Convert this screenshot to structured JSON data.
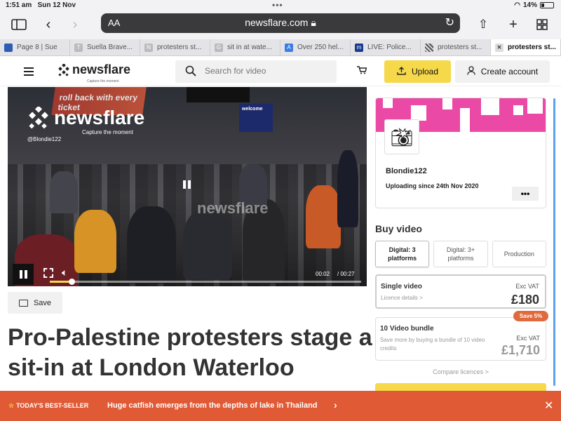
{
  "status_bar": {
    "time": "1:51 am",
    "date": "Sun 12 Nov",
    "battery": "14%"
  },
  "browser": {
    "text_size_label": "AA",
    "url": "newsflare.com",
    "tabs": [
      {
        "label": "Page 8 | Sue",
        "favicon": "leaf"
      },
      {
        "label": "Suella Brave...",
        "favicon": "T"
      },
      {
        "label": "protesters st...",
        "favicon": "N"
      },
      {
        "label": "sit in at wate...",
        "favicon": "G"
      },
      {
        "label": "Over 250 hel...",
        "favicon": "AoL"
      },
      {
        "label": "LIVE: Police...",
        "favicon": "m"
      },
      {
        "label": "protesters st...",
        "favicon": "nf"
      },
      {
        "label": "protesters st...",
        "favicon": "close",
        "active": true
      }
    ]
  },
  "site": {
    "logo": "newsflare",
    "logo_tagline": "Capture the moment",
    "search_placeholder": "Search for video",
    "upload_label": "Upload",
    "account_label": "Create account"
  },
  "video": {
    "overlay_logo": "newsflare",
    "overlay_tagline": "Capture the moment",
    "overlay_user": "@Blondie122",
    "watermark": "newsflare",
    "scene_sign": "roll back with every ticket",
    "scene_welcome": "welcome",
    "current_time": "00:02",
    "duration": "/ 00:27",
    "progress": 0.07
  },
  "save_label": "Save",
  "headline": "Pro-Palestine protesters stage a sit-in at London Waterloo",
  "uploader": {
    "name": "Blondie122",
    "since": "Uploading since 24th Nov 2020",
    "more_label": "•••",
    "avatar_icon": "camera-flash-icon"
  },
  "buy": {
    "title": "Buy video",
    "tabs": [
      "Digital: 3 platforms",
      "Digital: 3+ platforms",
      "Production"
    ],
    "active_tab": 0,
    "single": {
      "title": "Single video",
      "sub": "Licence details >",
      "vat": "Exc VAT",
      "price": "£180"
    },
    "bundle": {
      "title": "10 Video bundle",
      "sub": "Save more by buying a bundle of 10 video credits",
      "vat": "Exc VAT",
      "price": "£1,710",
      "badge": "Save 5%"
    },
    "compare": "Compare licences >"
  },
  "banner": {
    "best_label": "TODAY'S BEST-SELLER",
    "text": "Huge catfish emerges from the depths of lake in Thailand"
  },
  "colors": {
    "accent_yellow": "#f6d94a",
    "banner_orange": "#e05a36",
    "pattern_pink": "#ea4aa6"
  }
}
